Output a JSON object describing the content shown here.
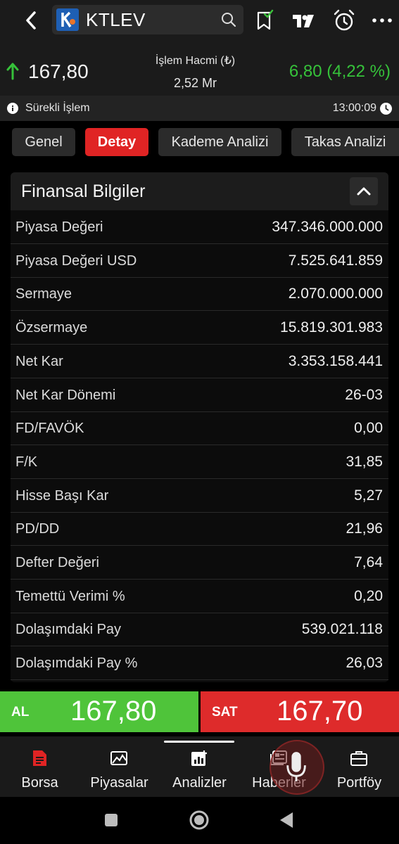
{
  "app": {
    "symbol": "KTLEV",
    "colors": {
      "accent_red": "#e02424",
      "up_green": "#36c23a",
      "buy_green": "#4fc43a",
      "sell_red": "#de2b2b"
    }
  },
  "quote": {
    "last_price": "167,80",
    "volume_label": "İşlem Hacmi (₺)",
    "volume_value": "2,52 Mr",
    "change": "6,80 (4,22 %)",
    "session": "Sürekli İşlem",
    "time": "13:00:09"
  },
  "tabs": [
    {
      "label": "Genel"
    },
    {
      "label": "Detay"
    },
    {
      "label": "Kademe Analizi"
    },
    {
      "label": "Takas Analizi"
    }
  ],
  "financials": {
    "title": "Finansal Bilgiler",
    "rows": [
      {
        "label": "Piyasa Değeri",
        "value": "347.346.000.000"
      },
      {
        "label": "Piyasa Değeri USD",
        "value": "7.525.641.859"
      },
      {
        "label": "Sermaye",
        "value": "2.070.000.000"
      },
      {
        "label": "Özsermaye",
        "value": "15.819.301.983"
      },
      {
        "label": "Net Kar",
        "value": "3.353.158.441"
      },
      {
        "label": "Net Kar Dönemi",
        "value": "26-03"
      },
      {
        "label": "FD/FAVÖK",
        "value": "0,00"
      },
      {
        "label": "F/K",
        "value": "31,85"
      },
      {
        "label": "Hisse Başı Kar",
        "value": "5,27"
      },
      {
        "label": "PD/DD",
        "value": "21,96"
      },
      {
        "label": "Defter Değeri",
        "value": "7,64"
      },
      {
        "label": "Temettü Verimi %",
        "value": "0,20"
      },
      {
        "label": "Dolaşımdaki Pay",
        "value": "539.021.118"
      },
      {
        "label": "Dolaşımdaki Pay %",
        "value": "26,03"
      }
    ]
  },
  "trade": {
    "buy_label": "AL",
    "buy_price": "167,80",
    "sell_label": "SAT",
    "sell_price": "167,70"
  },
  "nav": [
    {
      "label": "Borsa",
      "icon": "document-icon"
    },
    {
      "label": "Piyasalar",
      "icon": "chart-image-icon"
    },
    {
      "label": "Analizler",
      "icon": "analysis-icon"
    },
    {
      "label": "Haberler",
      "icon": "news-icon"
    },
    {
      "label": "Portföy",
      "icon": "briefcase-icon"
    }
  ]
}
